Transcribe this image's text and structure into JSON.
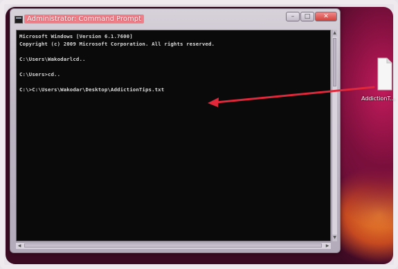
{
  "window": {
    "title": "Administrator: Command Prompt",
    "controls": {
      "minimize": "–",
      "maximize": "□",
      "close": "✕"
    }
  },
  "console": {
    "lines": [
      "Microsoft Windows [Version 6.1.7600]",
      "Copyright (c) 2009 Microsoft Corporation.  All rights reserved.",
      "",
      "C:\\Users\\Wakodarlcd..",
      "",
      "C:\\Users>cd..",
      "",
      "C:\\>C:\\Users\\Wakodar\\Desktop\\AddictionTips.txt"
    ]
  },
  "desktop": {
    "file_label": "AddictionT..."
  },
  "annotation": {
    "arrow_color": "#e0283a"
  },
  "icons": {
    "window_icon": "cmd-icon",
    "file_icon": "text-file-icon"
  }
}
